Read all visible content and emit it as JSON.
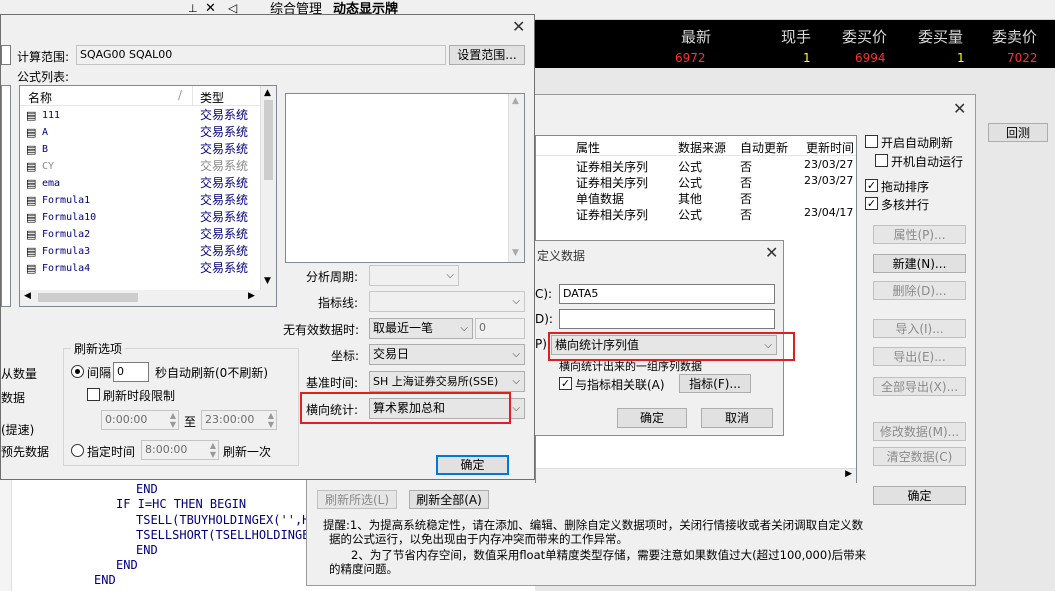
{
  "top_tabs": [
    "综合管理",
    "动态显示牌"
  ],
  "quote_bar": {
    "headers": [
      "最新",
      "现手",
      "委买价",
      "委买量",
      "委卖价"
    ],
    "values": [
      "6972",
      "1",
      "6994",
      "1",
      "7022"
    ]
  },
  "back_code": [
    "END",
    "IF I=HC THEN BEGIN",
    "TSELL(TBUYHOLDINGEX('',H",
    "TSELLSHORT(TSELLHOLDINGE",
    "END",
    "END",
    "END"
  ],
  "formula_dialog": {
    "range_label": "计算范围:",
    "range_value": "SQAG00  SQAL00",
    "set_range_button": "设置范围...",
    "formula_list_label": "公式列表:",
    "columns": [
      "名称",
      "类型"
    ],
    "rows": [
      {
        "name": "111",
        "type": "交易系统"
      },
      {
        "name": "A",
        "type": "交易系统"
      },
      {
        "name": "B",
        "type": "交易系统"
      },
      {
        "name": "CY",
        "type": "交易系统"
      },
      {
        "name": "ema",
        "type": "交易系统"
      },
      {
        "name": "Formula1",
        "type": "交易系统"
      },
      {
        "name": "Formula10",
        "type": "交易系统"
      },
      {
        "name": "Formula2",
        "type": "交易系统"
      },
      {
        "name": "Formula3",
        "type": "交易系统"
      },
      {
        "name": "Formula4",
        "type": "交易系统"
      }
    ],
    "period_label": "分析周期:",
    "indicator_label": "指标线:",
    "invalid_label": "无有效数据时:",
    "invalid_value": "取最近一笔",
    "invalid_num": "0",
    "axis_label": "坐标:",
    "axis_value": "交易日",
    "base_time_label": "基准时间:",
    "base_time_value": "SH 上海证券交易所(SSE)",
    "horizontal_label": "横向统计:",
    "horizontal_value": "算术累加总和",
    "refresh_title": "刷新选项",
    "interval_label": "间隔",
    "interval_value": "0",
    "interval_suffix": "秒自动刷新(0不刷新)",
    "time_limit_label": "刷新时段限制",
    "time_from": "0:00:00",
    "time_to_label": "至",
    "time_to": "23:00:00",
    "fixed_time_label": "指定时间",
    "fixed_time_value": "8:00:00",
    "refresh_once": "刷新一次",
    "left_labels": [
      "从数量",
      "数据",
      "(提速)",
      "预先数据"
    ],
    "ok_button": "确定"
  },
  "data_dialog": {
    "columns": [
      "属性",
      "数据来源",
      "自动更新",
      "更新时间"
    ],
    "rows": [
      {
        "attr": "证券相关序列",
        "src": "公式",
        "auto": "否",
        "time": "23/03/27"
      },
      {
        "attr": "证券相关序列",
        "src": "公式",
        "auto": "否",
        "time": "23/03/27"
      },
      {
        "attr": "单值数据",
        "src": "其他",
        "auto": "否",
        "time": ""
      },
      {
        "attr": "证券相关序列",
        "src": "公式",
        "auto": "否",
        "time": "23/04/17"
      }
    ],
    "opt_auto_refresh": "开启自动刷新",
    "opt_boot_run": "开机自动运行",
    "opt_drag_sort": "拖动排序",
    "opt_multicore": "多核并行",
    "btn_property": "属性(P)...",
    "btn_new": "新建(N)...",
    "btn_delete": "删除(D)...",
    "btn_import": "导入(I)...",
    "btn_export": "导出(E)...",
    "btn_export_all": "全部导出(X)...",
    "btn_modify": "修改数据(M)...",
    "btn_clear": "清空数据(C)",
    "btn_ok": "确定",
    "btn_refresh_selected": "刷新所选(L)",
    "btn_refresh_all": "刷新全部(A)",
    "back_button": "回测",
    "note_line1": "提醒:1、为提高系统稳定性，请在添加、编辑、删除自定义数据项时，关闭行情接收或者关闭调取自定义数",
    "note_line2": "据的公式运行，以免出现由于内存冲突而带来的工作异常。",
    "note_line3": "2、为了节省内存空间，数值采用float单精度类型存储，需要注意如果数值过大(超过100,000)后带来",
    "note_line4": "的精度问题。"
  },
  "custom_dialog": {
    "title": "定义数据",
    "code_prefix": "C):",
    "code_value": "DATA5",
    "name_prefix": "D):",
    "type_prefix": "P)",
    "type_value": "横向统计序列值",
    "hint": "横向统计出来的一组序列数据",
    "link_label": "与指标相关联(A)",
    "indicator_button": "指标(F)...",
    "ok": "确定",
    "cancel": "取消"
  }
}
